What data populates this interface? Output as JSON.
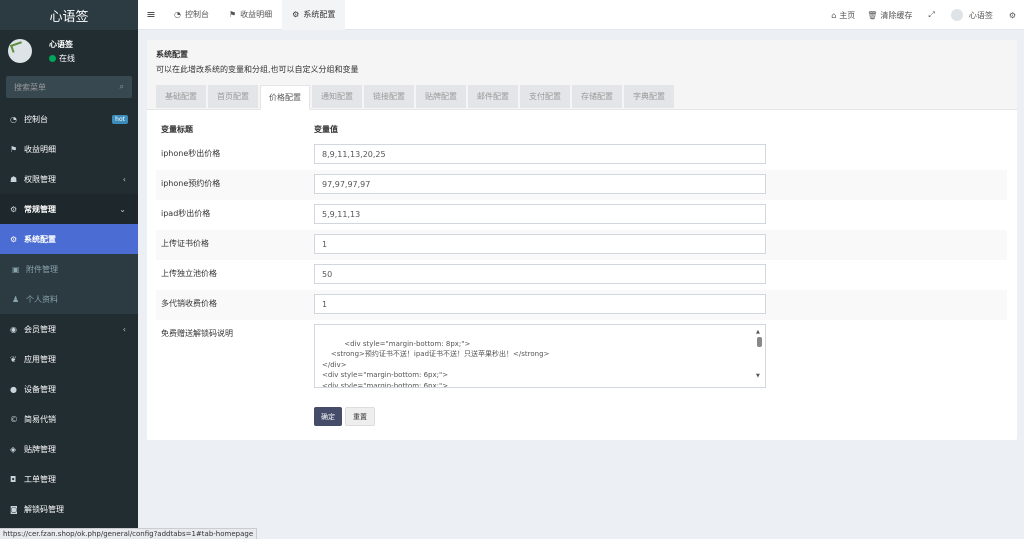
{
  "app": {
    "title": "心语签"
  },
  "user": {
    "name": "心语签",
    "status": "在线"
  },
  "sidebar": {
    "search_placeholder": "搜索菜单",
    "items": [
      {
        "label": "控制台",
        "icon": "dashboard-icon",
        "badge": "hot"
      },
      {
        "label": "收益明细",
        "icon": "flag-icon"
      },
      {
        "label": "权限管理",
        "icon": "group-icon",
        "chevron": "‹"
      },
      {
        "label": "常规管理",
        "icon": "cogs-icon",
        "chevron": "⌄"
      },
      {
        "label": "系统配置",
        "icon": "cog-icon"
      },
      {
        "label": "附件管理",
        "icon": "file-image-icon"
      },
      {
        "label": "个人资料",
        "icon": "user-icon"
      },
      {
        "label": "会员管理",
        "icon": "user-circle-icon",
        "chevron": "‹"
      },
      {
        "label": "应用管理",
        "icon": "leaf-icon"
      },
      {
        "label": "设备管理",
        "icon": "circle-icon"
      },
      {
        "label": "简易代销",
        "icon": "copyright-icon"
      },
      {
        "label": "贴牌管理",
        "icon": "tags-icon"
      },
      {
        "label": "工单管理",
        "icon": "car-icon"
      },
      {
        "label": "解锁码管理",
        "icon": "unlock-icon"
      }
    ]
  },
  "topbar": {
    "tabs": [
      "控制台",
      "收益明细",
      "系统配置"
    ],
    "home": "主页",
    "clear_cache": "清除缓存",
    "username": "心语签"
  },
  "config": {
    "title": "系统配置",
    "description": "可以在此增改系统的变量和分组,也可以自定义分组和变量",
    "tabs": [
      "基础配置",
      "首页配置",
      "价格配置",
      "通知配置",
      "链接配置",
      "贴牌配置",
      "邮件配置",
      "支付配置",
      "存储配置",
      "字典配置"
    ],
    "active_tab": "价格配置",
    "col_title": "变量标题",
    "col_value": "变量值",
    "rows": [
      {
        "label": "iphone秒出价格",
        "value": "8,9,11,13,20,25"
      },
      {
        "label": "iphone预约价格",
        "value": "97,97,97,97"
      },
      {
        "label": "ipad秒出价格",
        "value": "5,9,11,13"
      },
      {
        "label": "上传证书价格",
        "value": "1"
      },
      {
        "label": "上传独立池价格",
        "value": "50"
      },
      {
        "label": "多代销收费价格",
        "value": "1"
      }
    ],
    "textarea_label": "免费赠送解锁码说明",
    "textarea_value": "<div style=\"margin-bottom: 8px;\">\n    <strong>预约证书不送！ipad证书不送！只送苹果秒出！</strong>\n</div>\n<div style=\"margin-bottom: 6px;\">\n<div style=\"margin-bottom: 6px;\">",
    "btn_ok": "确定",
    "btn_reset": "重置"
  },
  "statusbar": "https://cer.fzan.shop/ok.php/general/config?addtabs=1#tab-homepage"
}
